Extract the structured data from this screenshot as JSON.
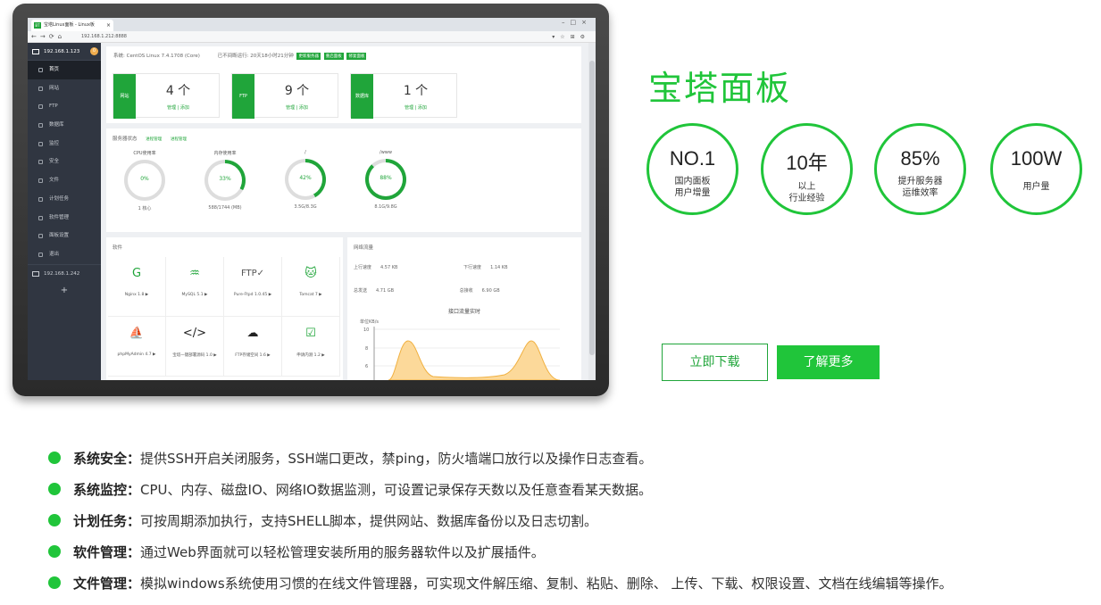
{
  "browser": {
    "tab_title": "宝塔Linux面板 - Linux板",
    "favicon": "BT",
    "url": "192.168.1.212:8888"
  },
  "sidebar": {
    "host": "192.168.1.123",
    "badge": "0",
    "items": [
      {
        "label": "首页",
        "icon": "home-icon"
      },
      {
        "label": "网站",
        "icon": "globe-icon"
      },
      {
        "label": "FTP",
        "icon": "ftp-icon"
      },
      {
        "label": "数据库",
        "icon": "database-icon"
      },
      {
        "label": "监控",
        "icon": "monitor-icon"
      },
      {
        "label": "安全",
        "icon": "shield-icon"
      },
      {
        "label": "文件",
        "icon": "folder-icon"
      },
      {
        "label": "计划任务",
        "icon": "calendar-icon"
      },
      {
        "label": "软件管理",
        "icon": "grid-icon"
      },
      {
        "label": "面板设置",
        "icon": "gear-icon"
      },
      {
        "label": "退出",
        "icon": "logout-icon"
      }
    ],
    "host2": "192.168.1.242",
    "add": "+"
  },
  "system": {
    "os": "系统: CentOS Linux 7.4.1708 (Core)",
    "uptime": "已不间断运行: 20天18小时21分钟",
    "buttons": [
      "更新服务器",
      "重启面板",
      "修复面板"
    ]
  },
  "stats": [
    {
      "label": "网站",
      "value": "4 个",
      "links": "管理 | 添加"
    },
    {
      "label": "FTP",
      "value": "9 个",
      "links": "管理 | 添加"
    },
    {
      "label": "数据库",
      "value": "1 个",
      "links": "管理 | 添加"
    }
  ],
  "status": {
    "title": "服务器状态",
    "sub1": "进程管理",
    "sub2": "进程管理",
    "gauges": [
      {
        "title": "CPU使用率",
        "pct": "0%",
        "value": 0,
        "bottom": "1 核心"
      },
      {
        "title": "内存使用率",
        "pct": "33%",
        "value": 33,
        "bottom": "588/1744 (MB)"
      },
      {
        "title": "/",
        "pct": "42%",
        "value": 42,
        "bottom": "3.5G/8.3G"
      },
      {
        "title": "/www",
        "pct": "88%",
        "value": 88,
        "bottom": "8.1G/9.8G"
      }
    ]
  },
  "software": {
    "title": "软件",
    "items": [
      {
        "name": "Nginx 1.8 ▶",
        "icon": "nginx-icon",
        "glyph": "G"
      },
      {
        "name": "MySQL 5.1 ▶",
        "icon": "mysql-icon",
        "glyph": "♒"
      },
      {
        "name": "Pure-Ftpd 1.0.45 ▶",
        "icon": "pureftpd-icon",
        "glyph": "FTP✓"
      },
      {
        "name": "Tomcat 7 ▶",
        "icon": "tomcat-icon",
        "glyph": "🐱"
      },
      {
        "name": "phpMyAdmin 4.7 ▶",
        "icon": "phpmyadmin-icon",
        "glyph": "⛵"
      },
      {
        "name": "宝塔一键部署源码 1.0 ▶",
        "icon": "code-icon",
        "glyph": "</>"
      },
      {
        "name": "FTP存储空间 1.6 ▶",
        "icon": "cloud-ftp-icon",
        "glyph": "☁"
      },
      {
        "name": "申请内测 1.2 ▶",
        "icon": "clipboard-icon",
        "glyph": "☑"
      }
    ]
  },
  "network": {
    "title": "网络流量",
    "up_label": "上行速度",
    "up_value": "4.57 KB",
    "down_label": "下行速度",
    "down_value": "1.14 KB",
    "sent_label": "总发送",
    "sent_value": "4.71 GB",
    "recv_label": "总接收",
    "recv_value": "6.90 GB",
    "chart_title": "接口流量实时",
    "unit": "单位KB/s",
    "ticks": [
      "10",
      "8",
      "6"
    ]
  },
  "hero": {
    "title": "宝塔面板",
    "circles": [
      {
        "big": "NO.1",
        "line1": "国内面板",
        "line2": "用户增量"
      },
      {
        "big": "10年",
        "line1": "以上",
        "line2": "行业经验"
      },
      {
        "big": "85%",
        "line1": "提升服务器",
        "line2": "运维效率"
      },
      {
        "big": "100W",
        "line1": "用户量",
        "line2": ""
      }
    ],
    "download": "立即下载",
    "learn": "了解更多"
  },
  "features": [
    {
      "title": "系统安全：",
      "text": "提供SSH开启关闭服务，SSH端口更改，禁ping，防火墙端口放行以及操作日志查看。"
    },
    {
      "title": "系统监控：",
      "text": "CPU、内存、磁盘IO、网络IO数据监测，可设置记录保存天数以及任意查看某天数据。"
    },
    {
      "title": "计划任务：",
      "text": "可按周期添加执行，支持SHELL脚本，提供网站、数据库备份以及日志切割。"
    },
    {
      "title": "软件管理：",
      "text": "通过Web界面就可以轻松管理安装所用的服务器软件以及扩展插件。"
    },
    {
      "title": "文件管理：",
      "text": "模拟windows系统使用习惯的在线文件管理器，可实现文件解压缩、复制、粘贴、删除、 上传、下载、权限设置、文档在线编辑等操作。"
    }
  ],
  "colors": {
    "accent": "#20c53a",
    "sidebar": "#303641"
  }
}
